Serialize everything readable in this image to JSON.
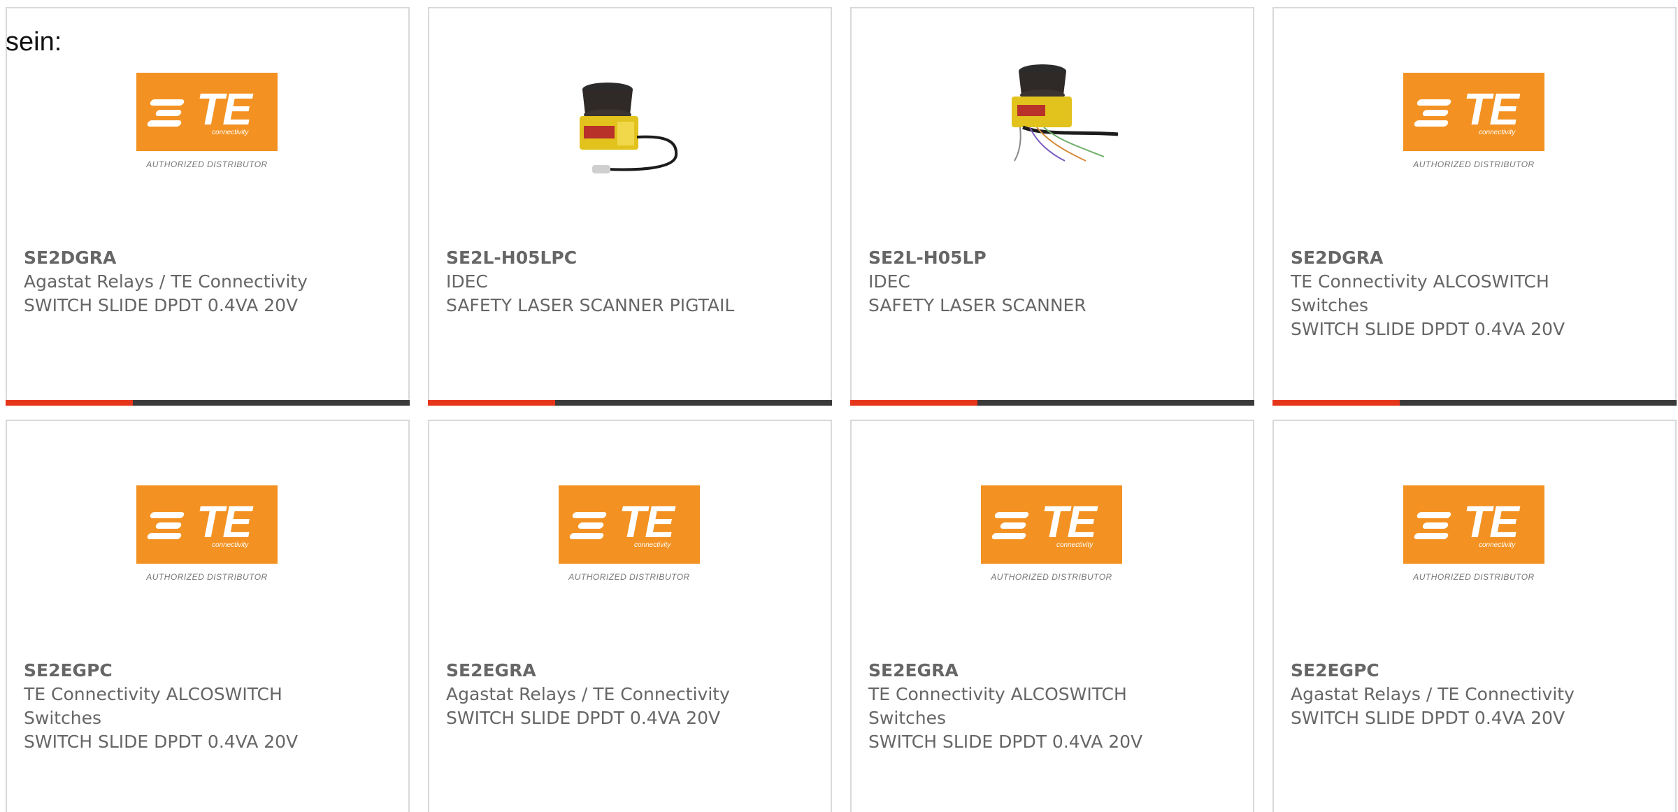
{
  "intro_text": "sein:",
  "colors": {
    "accent": "#e5361b",
    "bar": "#3a3a3a",
    "te_orange": "#f39222",
    "text": "#666666",
    "border": "#d9d9d9"
  },
  "te_logo": {
    "wordmark": "TE",
    "sub": "connectivity",
    "tagline": "AUTHORIZED DISTRIBUTOR"
  },
  "cards": [
    {
      "part": "SE2DGRA",
      "manufacturer": "Agastat Relays / TE Connectivity",
      "manufacturer_line2": "",
      "description": "SWITCH SLIDE DPDT 0.4VA 20V",
      "image": "te-logo"
    },
    {
      "part": "SE2L-H05LPC",
      "manufacturer": "IDEC",
      "manufacturer_line2": "",
      "description": "SAFETY LASER SCANNER PIGTAIL",
      "image": "laser-scanner-pigtail"
    },
    {
      "part": "SE2L-H05LP",
      "manufacturer": "IDEC",
      "manufacturer_line2": "",
      "description": "SAFETY LASER SCANNER",
      "image": "laser-scanner"
    },
    {
      "part": "SE2DGRA",
      "manufacturer": "TE Connectivity ALCOSWITCH",
      "manufacturer_line2": "Switches",
      "description": "SWITCH SLIDE DPDT 0.4VA 20V",
      "image": "te-logo"
    },
    {
      "part": "SE2EGPC",
      "manufacturer": "TE Connectivity ALCOSWITCH",
      "manufacturer_line2": "Switches",
      "description": "SWITCH SLIDE DPDT 0.4VA 20V",
      "image": "te-logo"
    },
    {
      "part": "SE2EGRA",
      "manufacturer": "Agastat Relays / TE Connectivity",
      "manufacturer_line2": "",
      "description": "SWITCH SLIDE DPDT 0.4VA 20V",
      "image": "te-logo"
    },
    {
      "part": "SE2EGRA",
      "manufacturer": "TE Connectivity ALCOSWITCH",
      "manufacturer_line2": "Switches",
      "description": "SWITCH SLIDE DPDT 0.4VA 20V",
      "image": "te-logo"
    },
    {
      "part": "SE2EGPC",
      "manufacturer": "Agastat Relays / TE Connectivity",
      "manufacturer_line2": "",
      "description": "SWITCH SLIDE DPDT 0.4VA 20V",
      "image": "te-logo"
    }
  ]
}
